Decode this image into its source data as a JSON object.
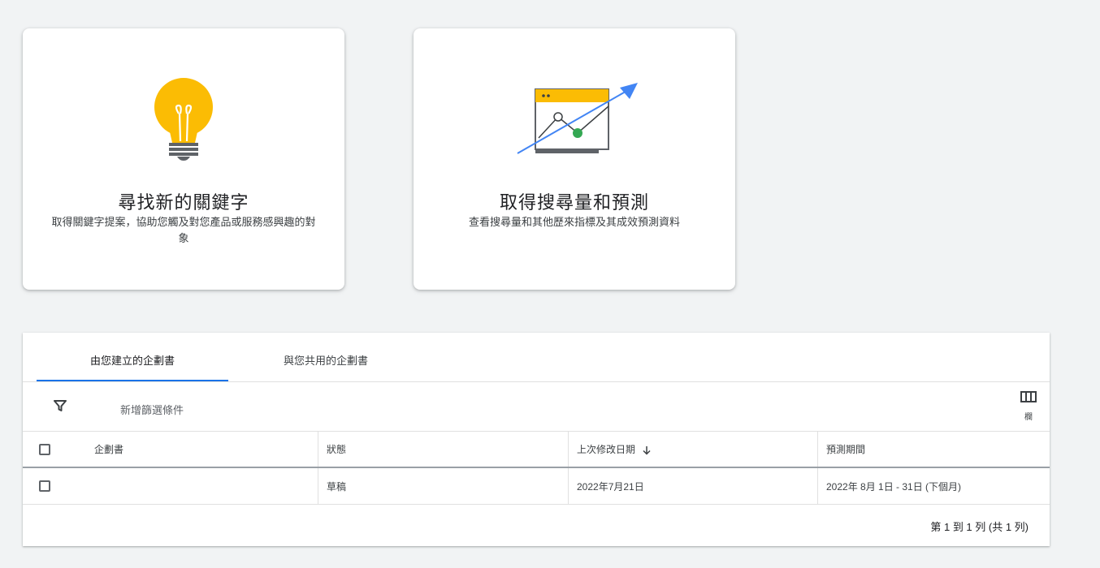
{
  "cards": [
    {
      "title": "尋找新的關鍵字",
      "description": "取得關鍵字提案，協助您觸及對您產品或服務感興趣的對象",
      "icon": "lightbulb-icon"
    },
    {
      "title": "取得搜尋量和預測",
      "description": "查看搜尋量和其他歷來指標及其成效預測資料",
      "icon": "chart-trend-icon"
    }
  ],
  "tabs": [
    {
      "label": "由您建立的企劃書",
      "active": true
    },
    {
      "label": "與您共用的企劃書",
      "active": false
    }
  ],
  "toolbar": {
    "add_filter_label": "新增篩選條件",
    "columns_label": "欄"
  },
  "table": {
    "headers": {
      "plan": "企劃書",
      "status": "狀態",
      "last_modified": "上次修改日期",
      "forecast_period": "預測期間"
    },
    "rows": [
      {
        "plan": "",
        "status": "草稿",
        "last_modified": "2022年7月21日",
        "forecast_period": "2022年 8月 1日 - 31日 (下個月)"
      }
    ]
  },
  "pagination": {
    "text": "第 1 到 1 列 (共 1 列)"
  },
  "colors": {
    "accent": "#1a73e8",
    "bulb": "#fbbc04",
    "trend_arrow": "#4285f4",
    "point": "#34a853"
  }
}
